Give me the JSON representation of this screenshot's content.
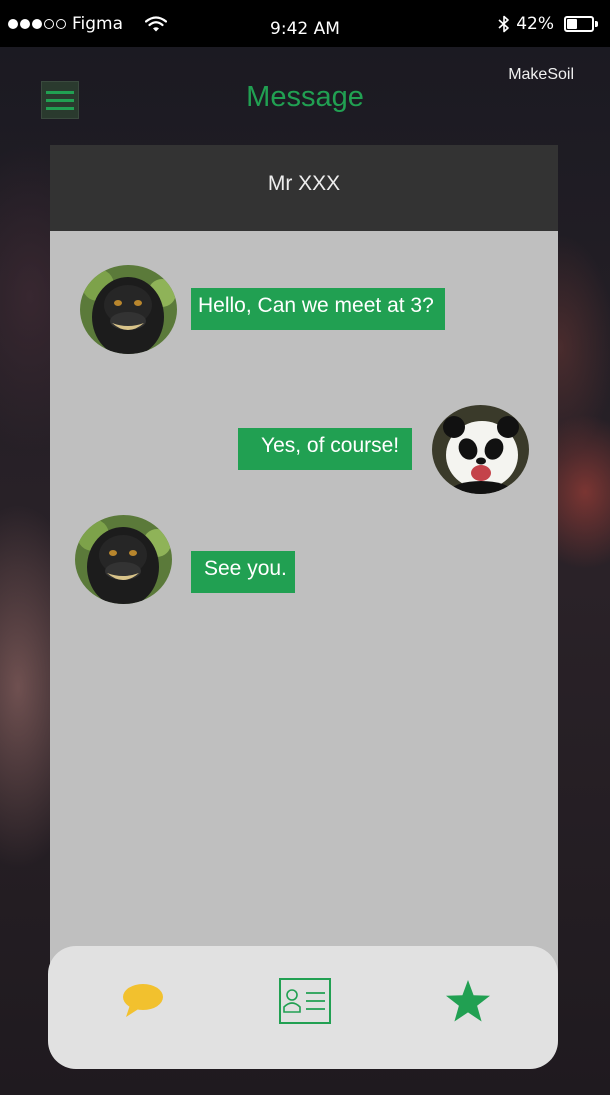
{
  "status_bar": {
    "carrier": "Figma",
    "time": "9:42 AM",
    "battery": "42%",
    "battery_level": 0.42,
    "signal_bars": 3,
    "signal_total": 5
  },
  "header": {
    "title": "Message",
    "brand": "MakeSoil",
    "menu_icon": "hamburger-menu-icon"
  },
  "chat": {
    "contact_name": "Mr XXX",
    "messages": [
      {
        "text": "Hello, Can we meet at 3?",
        "sender": "contact",
        "avatar": "monkey-avatar"
      },
      {
        "text": "Yes, of course!",
        "sender": "me",
        "avatar": "panda-avatar"
      },
      {
        "text": "See you.",
        "sender": "contact",
        "avatar": "monkey-avatar"
      }
    ]
  },
  "tab_bar": {
    "tabs": [
      {
        "icon": "chat-bubble-icon",
        "color": "#f2c12e"
      },
      {
        "icon": "contact-card-icon",
        "color": "#21a052"
      },
      {
        "icon": "star-icon",
        "color": "#21a052"
      }
    ]
  },
  "colors": {
    "accent": "#21a052",
    "chat_background": "#bfbfbf",
    "chat_header": "#333333",
    "tab_bar": "#e1e1e1"
  }
}
